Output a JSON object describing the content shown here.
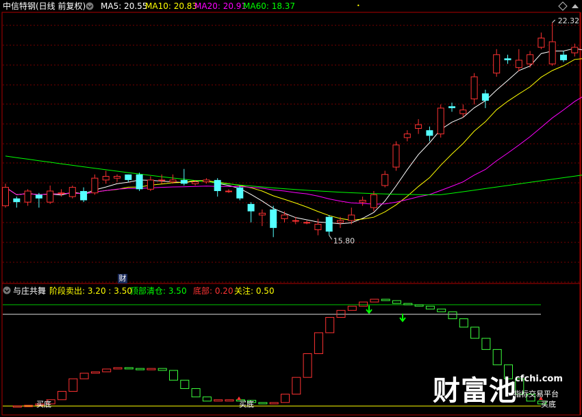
{
  "header": {
    "stock_title": "中信特钢(日线 前复权)",
    "ma_items": [
      {
        "label": "MA5: 20.55",
        "color": "#ffffff"
      },
      {
        "label": "MA10: 20.83",
        "color": "#ffff00"
      },
      {
        "label": "MA20: 20.91",
        "color": "#ff00ff"
      },
      {
        "label": "MA60: 18.37",
        "color": "#00ff00"
      }
    ]
  },
  "main_chart": {
    "high_annotation": "22.32",
    "low_annotation": "15.80",
    "badge": "财"
  },
  "indicator": {
    "title": "与庄共舞",
    "items": [
      {
        "label": "阶段卖出: 3.20 : 3.50",
        "color": "#ffff00"
      },
      {
        "label": "顶部清仓: 3.50",
        "color": "#00ff00"
      },
      {
        "label": "底部: 0.20",
        "color": "#ff3333"
      },
      {
        "label": "关注: 0.50",
        "color": "#ffff00"
      }
    ],
    "signal_label": "买底"
  },
  "watermark": {
    "brand": "财富池",
    "site": "cfchi.com",
    "subtitle": "指标交易平台"
  },
  "colors": {
    "up": "#ff3232",
    "down": "#54ffff",
    "ma5": "#ffffff",
    "ma10": "#ffff00",
    "ma20": "#ff00ff",
    "ma60": "#00ff00",
    "border": "#b00000",
    "osc_up": "#ff3232",
    "osc_down": "#3cff3c"
  }
}
